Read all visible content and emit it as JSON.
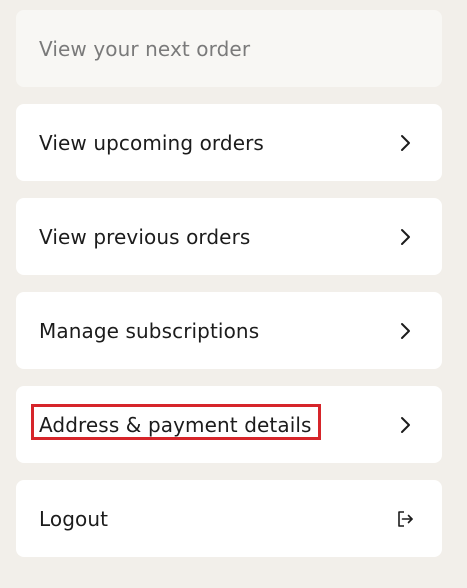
{
  "menu": {
    "items": [
      {
        "label": "View your next order",
        "icon": "none",
        "disabled": true
      },
      {
        "label": "View upcoming orders",
        "icon": "chevron-right-icon"
      },
      {
        "label": "View previous orders",
        "icon": "chevron-right-icon"
      },
      {
        "label": "Manage subscriptions",
        "icon": "chevron-right-icon"
      },
      {
        "label": "Address & payment details",
        "icon": "chevron-right-icon",
        "highlighted": true
      },
      {
        "label": "Logout",
        "icon": "logout-icon"
      }
    ]
  },
  "colors": {
    "background": "#f2efea",
    "card": "#ffffff",
    "disabled_card": "#f8f7f4",
    "highlight": "#d6252a",
    "text": "#1c1c1c",
    "disabled_text": "#7a7a7a"
  }
}
